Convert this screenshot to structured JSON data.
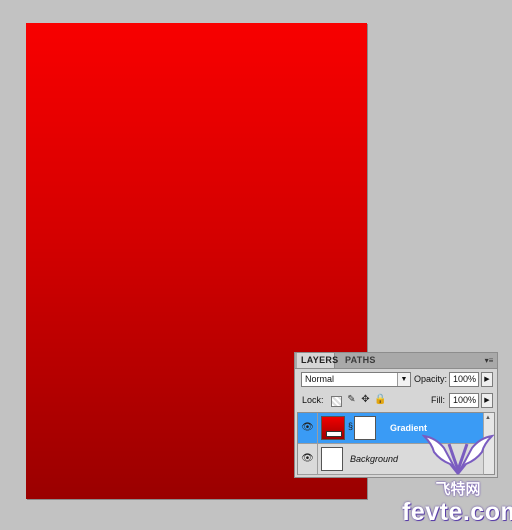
{
  "layers_panel": {
    "tabs": [
      {
        "label": "LAYERS",
        "active": true
      },
      {
        "label": "PATHS",
        "active": false
      }
    ],
    "blend_mode": "Normal",
    "opacity_label": "Opacity:",
    "opacity_value": "100%",
    "lock_label": "Lock:",
    "fill_label": "Fill:",
    "fill_value": "100%",
    "layers": [
      {
        "name": "Gradient",
        "selected": true,
        "visible": true,
        "has_mask": true
      },
      {
        "name": "Background",
        "selected": false,
        "visible": true,
        "has_mask": false
      }
    ]
  },
  "canvas": {
    "gradient_top": "#f80000",
    "gradient_bottom": "#9a0000"
  },
  "watermark": {
    "chinese_text": "飞特网",
    "url_text": "fevte.com"
  },
  "colors": {
    "workspace": "#c2c2c2",
    "selection": "#3a9bf5",
    "panel": "#d6d6d6"
  }
}
